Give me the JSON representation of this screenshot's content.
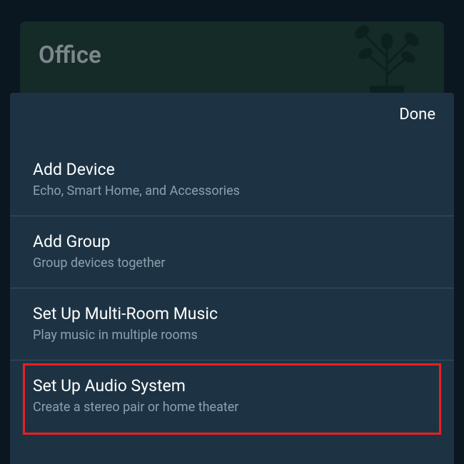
{
  "room": {
    "title": "Office"
  },
  "sheet": {
    "done_label": "Done",
    "items": [
      {
        "title": "Add Device",
        "subtitle": "Echo, Smart Home, and Accessories",
        "highlighted": false
      },
      {
        "title": "Add Group",
        "subtitle": "Group devices together",
        "highlighted": false
      },
      {
        "title": "Set Up Multi-Room Music",
        "subtitle": "Play music in multiple rooms",
        "highlighted": false
      },
      {
        "title": "Set Up Audio System",
        "subtitle": "Create a stereo pair or home theater",
        "highlighted": true
      }
    ]
  }
}
